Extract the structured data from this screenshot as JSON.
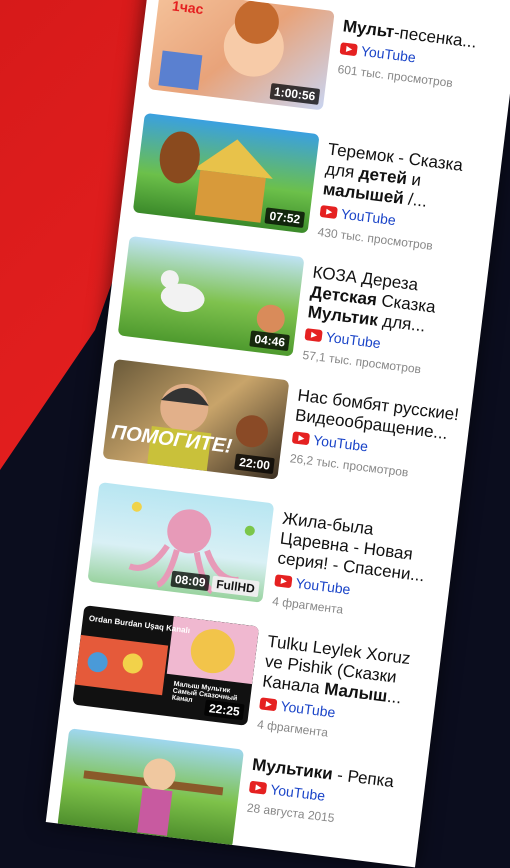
{
  "items": [
    {
      "title_bold": "Мульт",
      "title_rest": "-песенка...",
      "duration": "1:00:56",
      "overlay": "1час",
      "channel": "YouTube",
      "views": "601 тыс. просмотров"
    },
    {
      "title_pre": "Теремок - Сказка для ",
      "title_bold": "детей",
      "title_mid": " и ",
      "title_bold2": "малышей",
      "title_rest": " /...",
      "duration": "07:52",
      "channel": "YouTube",
      "views": "430 тыс. просмотров"
    },
    {
      "title_pre": "КОЗА Дереза ",
      "title_bold": "Детская",
      "title_mid": " Сказка ",
      "title_bold2": "Мультик",
      "title_rest": " для...",
      "duration": "04:46",
      "channel": "YouTube",
      "views": "57,1 тыс. просмотров"
    },
    {
      "title": "Нас бомбят русские! Видеообращение...",
      "duration": "22:00",
      "overlay": "ПОМОГИТЕ!",
      "channel": "YouTube",
      "views": "26,2 тыс. просмотров"
    },
    {
      "title": "Жила-была Царевна - Новая серия! - Спасени...",
      "duration": "08:09",
      "hd": "FullHD",
      "channel": "YouTube",
      "views": "4 фрагмента"
    },
    {
      "title_pre": "Tulku Leylek Xoruz ve Pishik (Сказки Канала ",
      "title_bold": "Малыш",
      "title_rest": "...",
      "duration": "22:25",
      "overlay": "Ordan Burdan Uşaq Kanalı",
      "overlay2": "Малыш Мультик Самый Сказочный Канал",
      "channel": "YouTube",
      "views": "4 фрагмента"
    },
    {
      "title_bold": "Мультики",
      "title_rest": " - Репка",
      "channel": "YouTube",
      "views": "28 августа 2015"
    }
  ],
  "colors": {
    "accent": "#e52121",
    "link": "#1a44c8",
    "bg": "#0b0d1e",
    "band": "#e52020"
  }
}
